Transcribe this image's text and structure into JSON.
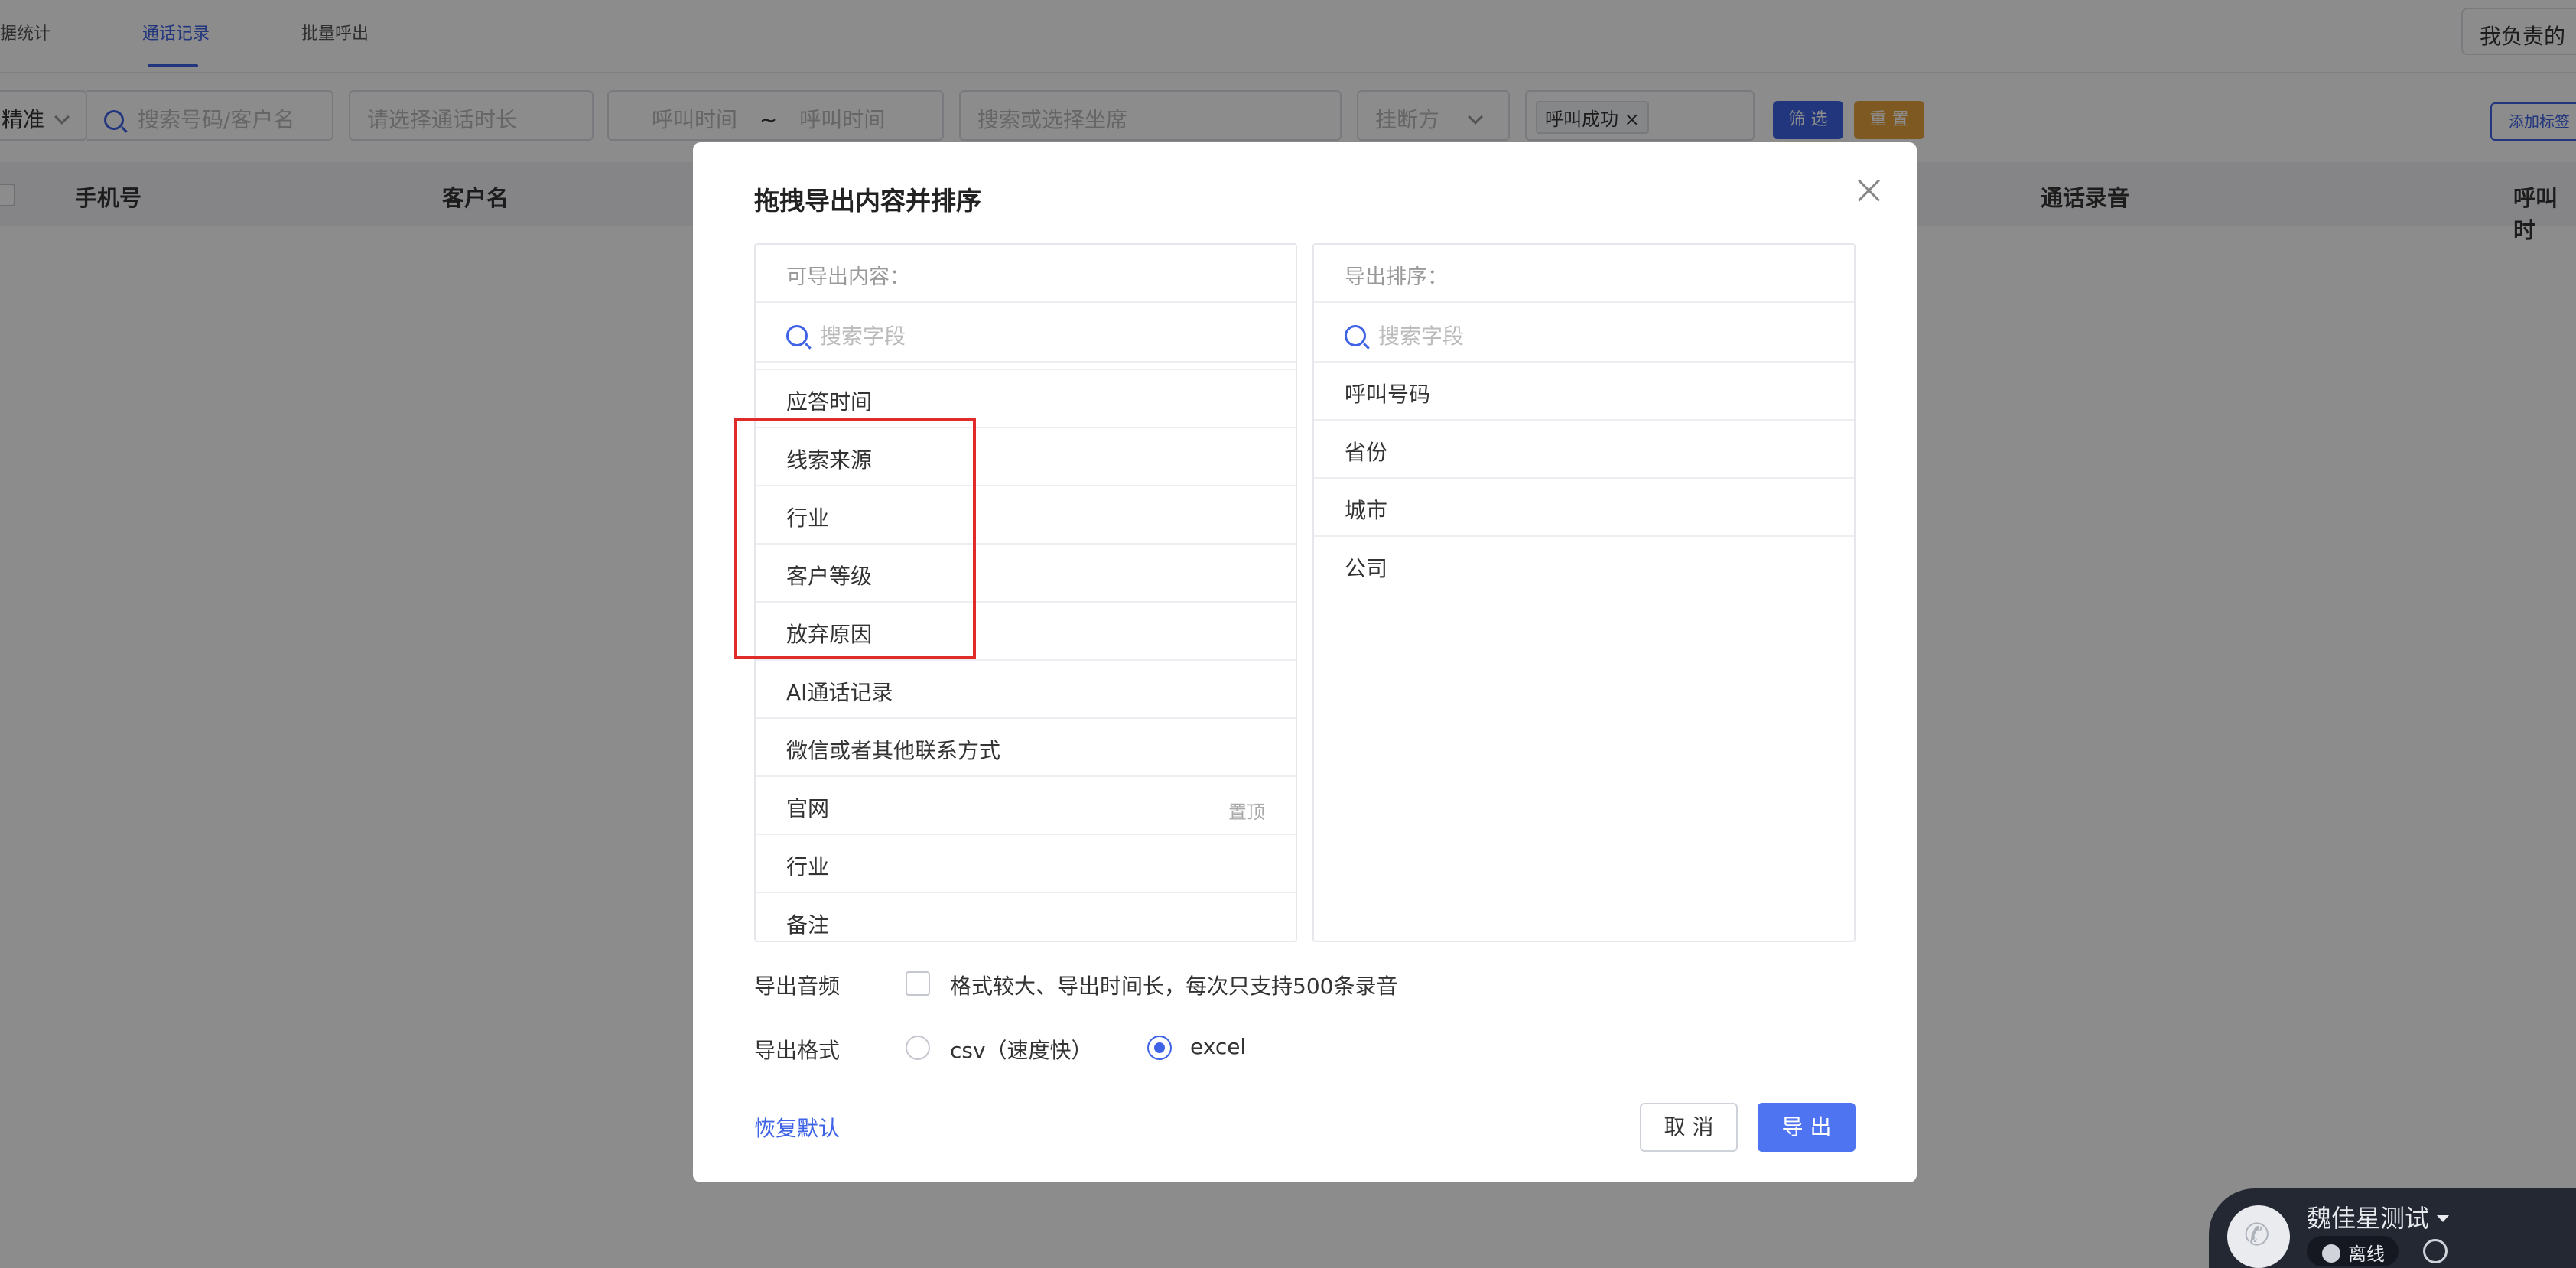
{
  "tabs": {
    "items": [
      "据统计",
      "通话记录",
      "批量呼出"
    ],
    "active_index": 1,
    "top_right_button": "我负责的"
  },
  "filters": {
    "match_mode": "精准",
    "search_placeholder": "搜索号码/客户名",
    "duration_placeholder": "请选择通话时长",
    "time_start_placeholder": "呼叫时间",
    "time_sep": "~",
    "time_end_placeholder": "呼叫时间",
    "seat_placeholder": "搜索或选择坐席",
    "hangup_placeholder": "挂断方",
    "status_tag": "呼叫成功",
    "tag_close": "×",
    "filter_button": "筛 选",
    "reset_button": "重 置",
    "add_tag_button": "添加标签"
  },
  "table_headers": {
    "phone": "手机号",
    "customer": "客户名",
    "recording": "通话录音",
    "call_time": "呼叫时"
  },
  "modal": {
    "title": "拖拽导出内容并排序",
    "available": {
      "header": "可导出内容：",
      "search_placeholder": "搜索字段",
      "items": [
        "应答时间",
        "线索来源",
        "行业",
        "客户等级",
        "放弃原因",
        "AI通话记录",
        "微信或者其他联系方式",
        "官网",
        "行业",
        "备注"
      ],
      "pin_label": "置顶"
    },
    "order": {
      "header": "导出排序：",
      "search_placeholder": "搜索字段",
      "items": [
        "呼叫号码",
        "省份",
        "城市",
        "公司"
      ]
    },
    "export_audio_label": "导出音频",
    "export_audio_hint": "格式较大、导出时间长，每次只支持500条录音",
    "export_audio_checked": false,
    "export_format_label": "导出格式",
    "format_options": [
      "csv（速度快）",
      "excel"
    ],
    "format_selected": "excel",
    "restore_default": "恢复默认",
    "cancel_button": "取 消",
    "export_button": "导 出"
  },
  "phone_widget": {
    "agent_name": "魏佳星测试",
    "status": "离线"
  },
  "colors": {
    "accent": "#3f63e6",
    "primary_button": "#4e74f2",
    "reset_button": "#e6a23c",
    "highlight": "#e02b2b"
  }
}
